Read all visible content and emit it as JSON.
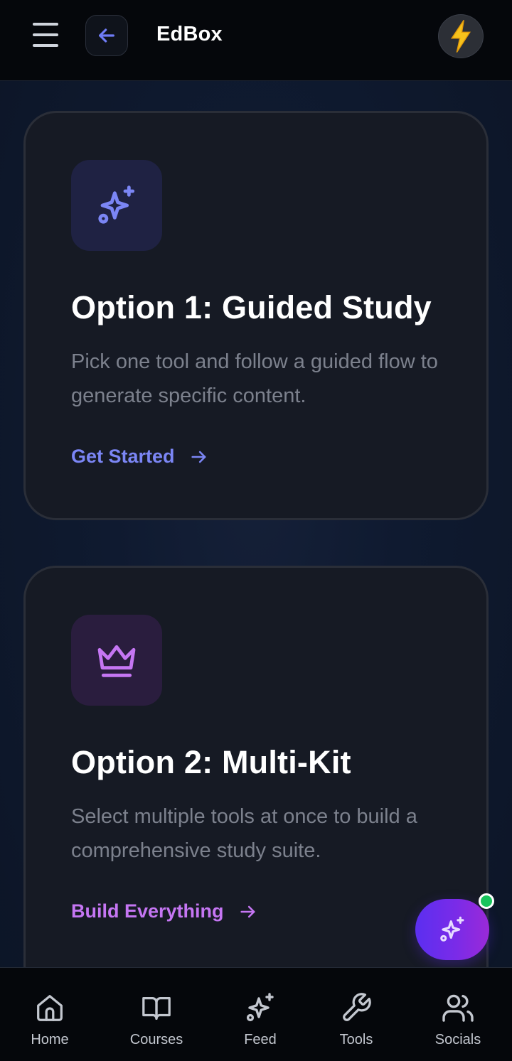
{
  "header": {
    "title": "EdBox",
    "menu_icon": "hamburger-menu-icon",
    "back_icon": "arrow-left-icon",
    "action_icon": "lightning-bolt-icon"
  },
  "cards": [
    {
      "icon": "sparkles-icon",
      "title": "Option 1: Guided Study",
      "description": "Pick one tool and follow a guided flow to generate specific content.",
      "cta": "Get Started",
      "accent": "#7b86f5"
    },
    {
      "icon": "crown-icon",
      "title": "Option 2: Multi-Kit",
      "description": "Select multiple tools at once to build a comprehensive study suite.",
      "cta": "Build Everything",
      "accent": "#c576f3"
    }
  ],
  "fab": {
    "icon": "sparkles-icon",
    "status_color": "#18c45c"
  },
  "bottom_nav": [
    {
      "label": "Home",
      "icon": "home-icon"
    },
    {
      "label": "Courses",
      "icon": "book-icon"
    },
    {
      "label": "Feed",
      "icon": "sparkles-icon"
    },
    {
      "label": "Tools",
      "icon": "wrench-icon"
    },
    {
      "label": "Socials",
      "icon": "users-icon"
    }
  ]
}
